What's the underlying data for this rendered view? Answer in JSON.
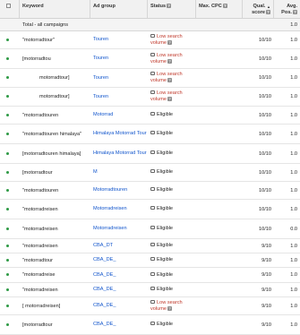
{
  "header": {
    "keyword": "Keyword",
    "ad_group": "Ad group",
    "status": "Status",
    "max_cpc": "Max. CPC",
    "qual_score_line1": "Qual.",
    "qual_score_line2": "score",
    "avg_pos_line1": "Avg.",
    "avg_pos_line2": "Pos.",
    "help_glyph": "?",
    "sort_glyph": "▲"
  },
  "total": {
    "label": "Total - all campaigns",
    "avg_pos": "1.0"
  },
  "rows": [
    {
      "keyword": "\"motorradtour\"",
      "ad_group": "Touren",
      "status_line1": "Low search",
      "status_line2": "volume",
      "status_low": true,
      "qs": "10/10",
      "pos": "1.0",
      "indent": false
    },
    {
      "keyword": "[motorradtou",
      "ad_group": "Touren",
      "status_line1": "Low search",
      "status_line2": "volume",
      "status_low": true,
      "qs": "10/10",
      "pos": "1.0",
      "indent": false
    },
    {
      "keyword": "motorradtour]",
      "ad_group": "Touren",
      "status_line1": "Low search",
      "status_line2": "volume",
      "status_low": true,
      "qs": "10/10",
      "pos": "1.0",
      "indent": true
    },
    {
      "keyword": "motorradtour]",
      "ad_group": "Touren",
      "status_line1": "Low search",
      "status_line2": "volume",
      "status_low": true,
      "qs": "10/10",
      "pos": "1.0",
      "indent": true
    },
    {
      "keyword": "\"motorradtouren",
      "ad_group": "Motorrad",
      "status_line1": "Eligible",
      "status_line2": "",
      "status_low": false,
      "qs": "10/10",
      "pos": "1.0",
      "indent": false
    },
    {
      "keyword": "\"motorradtouren himalaya\"",
      "ad_group": "Himalaya Motorrad Tour",
      "status_line1": "Eligible",
      "status_line2": "",
      "status_low": false,
      "qs": "10/10",
      "pos": "1.0",
      "indent": false
    },
    {
      "keyword": "[motorradtouren himalaya]",
      "ad_group": "Himalaya Motorrad Tour",
      "status_line1": "Eligible",
      "status_line2": "",
      "status_low": false,
      "qs": "10/10",
      "pos": "1.0",
      "indent": false
    },
    {
      "keyword": "[motorradtour",
      "ad_group": "M",
      "status_line1": "Eligible",
      "status_line2": "",
      "status_low": false,
      "qs": "10/10",
      "pos": "1.0",
      "indent": false
    },
    {
      "keyword": "\"motorradtouren",
      "ad_group": "Motorradtouren",
      "status_line1": "Eligible",
      "status_line2": "",
      "status_low": false,
      "qs": "10/10",
      "pos": "1.0",
      "indent": false
    },
    {
      "keyword": "\"motorradreisen",
      "ad_group": "Motorradreisen",
      "status_line1": "Eligible",
      "status_line2": "",
      "status_low": false,
      "qs": "10/10",
      "pos": "1.0",
      "indent": false
    },
    {
      "keyword": "\"motorradreisen",
      "ad_group": "Motorradreisen",
      "status_line1": "Eligible",
      "status_line2": "",
      "status_low": false,
      "qs": "10/10",
      "pos": "0.0",
      "indent": false
    },
    {
      "keyword": "\"motorradreisen",
      "ad_group": "CBA_DT",
      "status_line1": "Eligible",
      "status_line2": "",
      "status_low": false,
      "qs": "9/10",
      "pos": "1.0",
      "indent": false
    },
    {
      "keyword": "\"motorradtour",
      "ad_group": "CBA_DE_",
      "status_line1": "Eligible",
      "status_line2": "",
      "status_low": false,
      "qs": "9/10",
      "pos": "1.0",
      "indent": false
    },
    {
      "keyword": "\"motorradreise",
      "ad_group": "CBA_DE_",
      "status_line1": "Eligible",
      "status_line2": "",
      "status_low": false,
      "qs": "9/10",
      "pos": "1.0",
      "indent": false
    },
    {
      "keyword": "\"motorradreisen",
      "ad_group": "CBA_DE_",
      "status_line1": "Eligible",
      "status_line2": "",
      "status_low": false,
      "qs": "9/10",
      "pos": "1.0",
      "indent": false
    },
    {
      "keyword": "[ motorradreisen]",
      "ad_group": "CBA_DE_",
      "status_line1": "Low search",
      "status_line2": "volume",
      "status_low": true,
      "qs": "9/10",
      "pos": "1.0",
      "indent": false
    },
    {
      "keyword": "[motorradtour",
      "ad_group": "CBA_DE_",
      "status_line1": "Eligible",
      "status_line2": "",
      "status_low": false,
      "qs": "9/10",
      "pos": "1.0",
      "indent": false
    }
  ]
}
